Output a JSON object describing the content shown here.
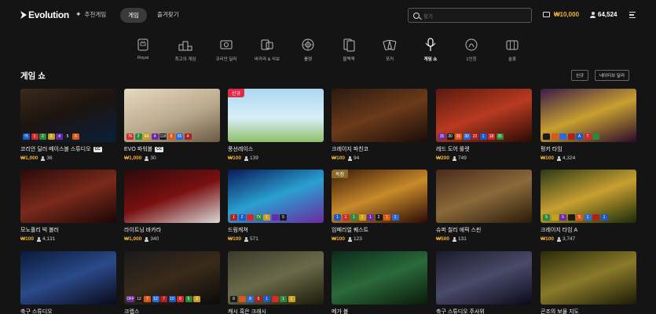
{
  "header": {
    "logo": "Evolution",
    "nav_recommend": "추천게임",
    "nav_game": "게임",
    "nav_fav": "즐겨찾기",
    "search_placeholder": "찾기",
    "balance": "₩10,000",
    "user_count": "64,524"
  },
  "categories": [
    {
      "label": "Royal",
      "icon": "royal-icon"
    },
    {
      "label": "최고의 게임",
      "icon": "podium-icon"
    },
    {
      "label": "코리안 딜러",
      "icon": "korean-dealer-icon"
    },
    {
      "label": "바카라 & 식보",
      "icon": "baccarat-icon"
    },
    {
      "label": "룰렛",
      "icon": "roulette-icon"
    },
    {
      "label": "블랙잭",
      "icon": "blackjack-icon"
    },
    {
      "label": "포커",
      "icon": "poker-icon"
    },
    {
      "label": "게임 쇼",
      "icon": "game-show-icon",
      "active": true
    },
    {
      "label": "1인칭",
      "icon": "first-person-icon"
    },
    {
      "label": "슬롯",
      "icon": "slots-icon"
    }
  ],
  "section": {
    "title": "게임 쇼",
    "sort_new": "신규",
    "sort_native": "네이티브 딜러"
  },
  "games": [
    {
      "title": "코리안 딜러 베이스볼 스튜디오",
      "cc": "CC",
      "bet": "₩1,000",
      "players": "36",
      "badge": "",
      "strip": [
        "어",
        "1",
        "2",
        "3",
        "4",
        "5",
        "6"
      ]
    },
    {
      "title": "EVO 파워볼",
      "cc": "CC",
      "bet": "₩1,000",
      "players": "30",
      "badge": "",
      "strip": [
        "76",
        "2",
        "64",
        "4",
        "118",
        "8",
        "65",
        "4"
      ]
    },
    {
      "title": "풍선레이스",
      "cc": "",
      "bet": "₩100",
      "players": "139",
      "badge": "신규",
      "strip": []
    },
    {
      "title": "크레이지 파친코",
      "cc": "",
      "bet": "₩100",
      "players": "94",
      "badge": "",
      "strip": []
    },
    {
      "title": "레드 도어 룰렛",
      "cc": "",
      "bet": "₩200",
      "players": "749",
      "badge": "",
      "strip": [
        "35",
        "30",
        "31",
        "30",
        "22",
        "1",
        "18",
        "35"
      ]
    },
    {
      "title": "펑키 타임",
      "cc": "",
      "bet": "₩100",
      "players": "4,324",
      "badge": "",
      "strip": [
        "",
        "",
        "",
        "",
        "A",
        "T",
        ""
      ]
    },
    {
      "title": "모노폴리 빅 볼러",
      "cc": "",
      "bet": "₩100",
      "players": "4,131",
      "badge": "",
      "strip": []
    },
    {
      "title": "라이트닝 바카라",
      "cc": "",
      "bet": "₩1,000",
      "players": "340",
      "badge": "",
      "strip": []
    },
    {
      "title": "드림캐쳐",
      "cc": "",
      "bet": "₩100",
      "players": "571",
      "badge": "",
      "strip": [
        "1",
        "2",
        "",
        "7X",
        "1",
        "",
        "5"
      ]
    },
    {
      "title": "임페리얼 퀘스트",
      "cc": "",
      "bet": "₩100",
      "players": "123",
      "badge": "독점",
      "strip": [
        "1",
        "1",
        "1",
        "1",
        "1",
        "2",
        "1",
        "1"
      ]
    },
    {
      "title": "슈퍼 칠리 에픽 스핀",
      "cc": "",
      "bet": "₩500",
      "players": "131",
      "badge": "",
      "strip": []
    },
    {
      "title": "크레이지 타임 A",
      "cc": "",
      "bet": "₩100",
      "players": "3,747",
      "badge": "",
      "strip": [
        "5",
        "",
        "5",
        "",
        "5",
        "1",
        "",
        "1"
      ]
    },
    {
      "title": "축구 스튜디오",
      "cc": "",
      "bet": "",
      "players": "",
      "badge": "",
      "strip": []
    },
    {
      "title": "크랩스",
      "cc": "",
      "bet": "",
      "players": "",
      "badge": "",
      "strip": [
        "OFF",
        "12",
        "7",
        "12",
        "7",
        "10",
        "6",
        "5",
        "3"
      ]
    },
    {
      "title": "캐시 혹은 크래시",
      "cc": "",
      "bet": "",
      "players": "",
      "badge": "",
      "strip": [
        "8",
        "",
        "8",
        "5",
        "1",
        "",
        "1",
        "1"
      ]
    },
    {
      "title": "메가 볼",
      "cc": "",
      "bet": "",
      "players": "",
      "badge": "",
      "strip": []
    },
    {
      "title": "축구 스튜디오 주사위",
      "cc": "",
      "bet": "",
      "players": "",
      "badge": "",
      "strip": []
    },
    {
      "title": "곤조의 보물 지도",
      "cc": "",
      "bet": "",
      "players": "",
      "badge": "",
      "strip": []
    }
  ],
  "colors": {
    "accent": "#f2b233",
    "new_badge": "#e02b4a",
    "background": "#141414"
  }
}
